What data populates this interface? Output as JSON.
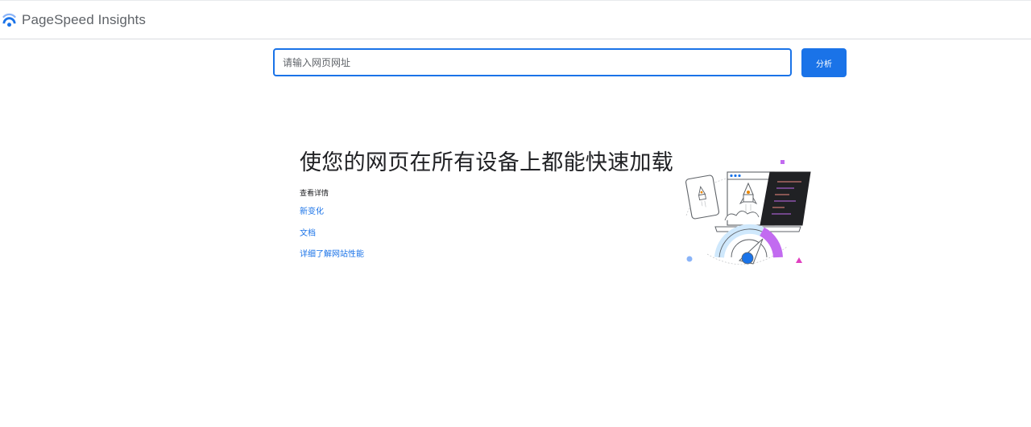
{
  "header": {
    "brand_name": "PageSpeed Insights",
    "logo_icon": "pagespeed-logo-icon"
  },
  "search": {
    "placeholder": "请输入网页网址",
    "value": "",
    "analyze_label": "分析"
  },
  "hero": {
    "title": "使您的网页在所有设备上都能快速加载",
    "details_heading": "查看详情",
    "links": [
      {
        "label": "新变化"
      },
      {
        "label": "文档"
      },
      {
        "label": "详细了解网站性能"
      }
    ],
    "illustration_icon": "rocket-speed-gauge-illustration"
  },
  "colors": {
    "accent": "#1a73e8",
    "brand_text": "#5f6368",
    "gauge_purple": "#c26bf0",
    "gauge_light": "#cfe8fc"
  }
}
